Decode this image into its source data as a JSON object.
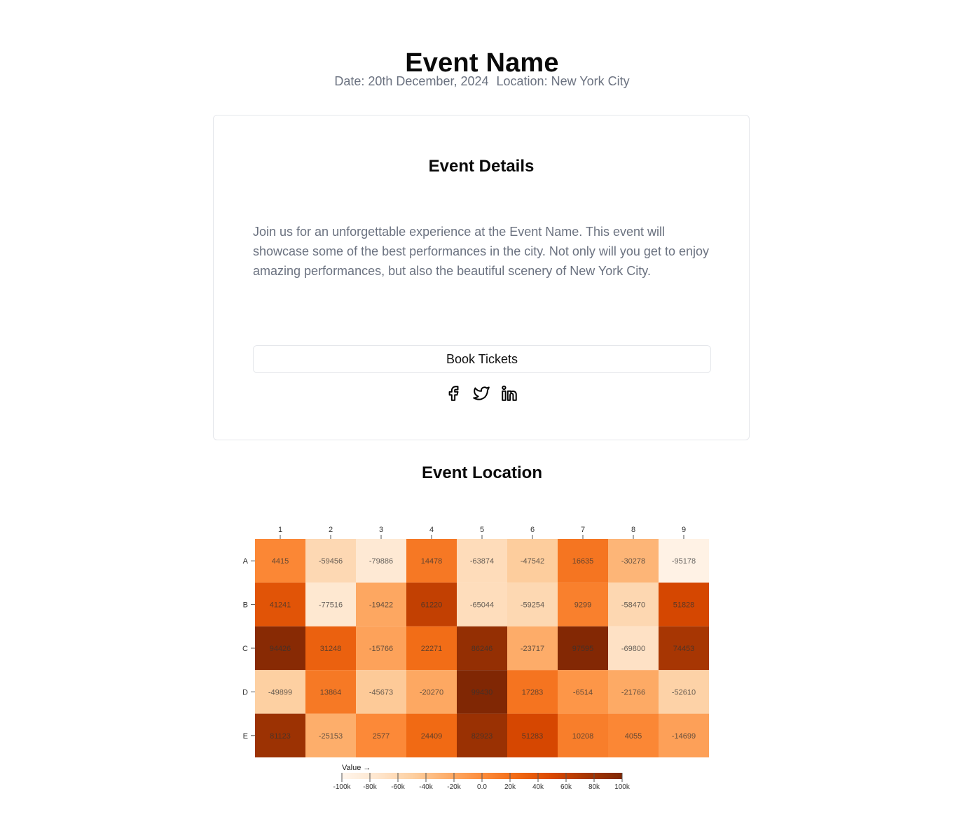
{
  "event": {
    "name": "Event Name",
    "date": "Date: 20th December, 2024",
    "location": "Location: New York City"
  },
  "details": {
    "title": "Event Details",
    "description": "Join us for an unforgettable experience at the Event Name. This event will showcase some of the best performances in the city. Not only will you get to enjoy amazing performances, but also the beautiful scenery of New York City.",
    "book_label": "Book Tickets"
  },
  "social": {
    "icons": [
      "facebook-icon",
      "twitter-icon",
      "linkedin-icon"
    ]
  },
  "location_section": {
    "title": "Event Location"
  },
  "chart_data": {
    "type": "heatmap",
    "x_categories": [
      "1",
      "2",
      "3",
      "4",
      "5",
      "6",
      "7",
      "8",
      "9"
    ],
    "y_categories": [
      "A",
      "B",
      "C",
      "D",
      "E"
    ],
    "values": [
      [
        4415,
        -59456,
        -79886,
        14478,
        -63874,
        -47542,
        16635,
        -30278,
        -95178
      ],
      [
        41241,
        -77516,
        -19422,
        61220,
        -65044,
        -59254,
        9299,
        -58470,
        51828
      ],
      [
        94426,
        31248,
        -15766,
        22271,
        86246,
        -23717,
        97595,
        -69800,
        74453
      ],
      [
        -49899,
        13864,
        -45673,
        -20270,
        99430,
        17283,
        -6514,
        -21766,
        -52610
      ],
      [
        81123,
        -25153,
        2577,
        24409,
        82923,
        51283,
        10208,
        4055,
        -14699
      ]
    ],
    "legend": {
      "title": "Value →",
      "domain": [
        -100000,
        100000
      ],
      "tick_values": [
        -100000,
        -80000,
        -60000,
        -40000,
        -20000,
        0,
        20000,
        40000,
        60000,
        80000,
        100000
      ],
      "tick_labels": [
        "-100k",
        "-80k",
        "-60k",
        "-40k",
        "-20k",
        "0.0",
        "20k",
        "40k",
        "60k",
        "80k",
        "100k"
      ]
    },
    "color_scheme": [
      "#fff5eb",
      "#fee6ce",
      "#fdd0a2",
      "#fdae6b",
      "#fd8d3c",
      "#f16913",
      "#d94801",
      "#a63603",
      "#7f2704"
    ]
  }
}
